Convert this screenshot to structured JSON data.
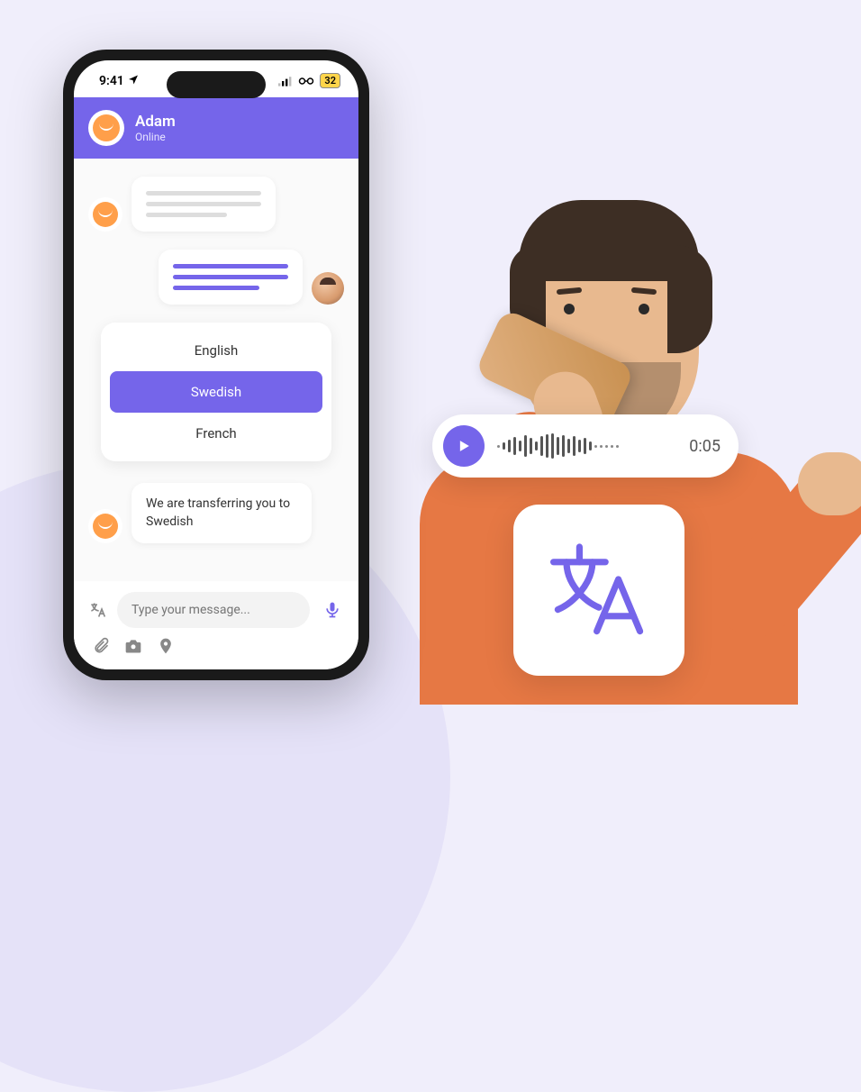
{
  "status_bar": {
    "time": "9:41",
    "battery": "32"
  },
  "chat_header": {
    "name": "Adam",
    "status": "Online"
  },
  "language_picker": {
    "options": [
      "English",
      "Swedish",
      "French"
    ],
    "selected": "Swedish"
  },
  "transfer_message": "We are transferring you to Swedish",
  "input": {
    "placeholder": "Type your message..."
  },
  "audio": {
    "time": "0:05"
  },
  "colors": {
    "accent": "#7565ea"
  }
}
